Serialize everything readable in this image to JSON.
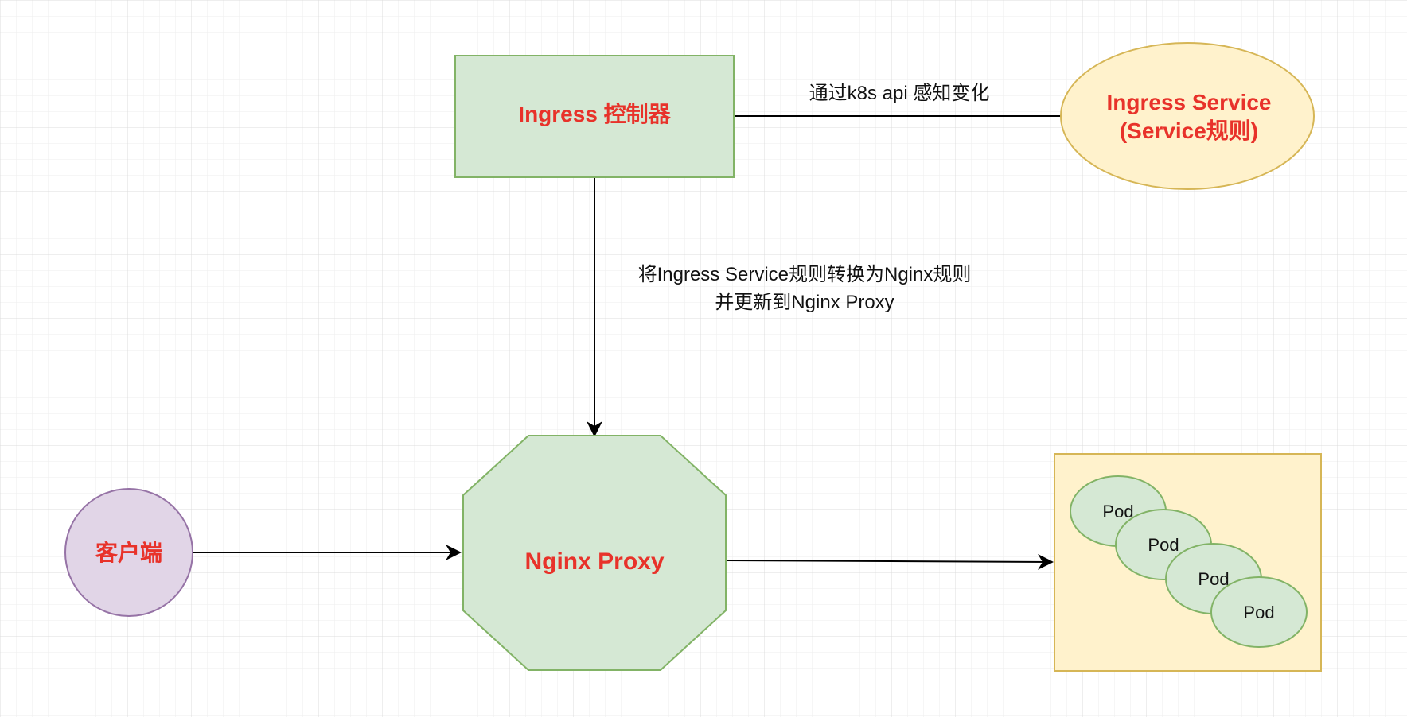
{
  "nodes": {
    "ingress_controller": {
      "label": "Ingress 控制器"
    },
    "ingress_service": {
      "line1": "Ingress Service",
      "line2": "(Service规则)"
    },
    "nginx_proxy": {
      "label": "Nginx Proxy"
    },
    "client": {
      "label": "客户端"
    },
    "pods": [
      "Pod",
      "Pod",
      "Pod",
      "Pod"
    ]
  },
  "edges": {
    "watch_label": "通过k8s api 感知变化",
    "convert_label_line1": "将Ingress Service规则转换为Nginx规则",
    "convert_label_line2": "并更新到Nginx Proxy"
  },
  "colors": {
    "grid": "#e6e6e6",
    "green_fill": "#d5e8d4",
    "green_stroke": "#82b366",
    "yellow_fill": "#fff2cc",
    "yellow_stroke": "#d6b656",
    "purple_fill": "#e1d5e7",
    "purple_stroke": "#9673a6",
    "red_text": "#e8322a",
    "edge": "#000000"
  }
}
